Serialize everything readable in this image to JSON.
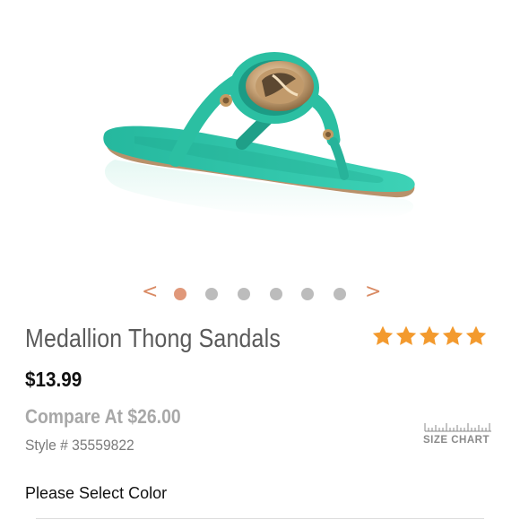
{
  "carousel": {
    "prev_icon": "chevron-left-icon",
    "next_icon": "chevron-right-icon",
    "prev_glyph": "<",
    "next_glyph": ">",
    "dot_count": 6,
    "active_index": 0
  },
  "product": {
    "title": "Medallion Thong Sandals",
    "rating_stars": 5,
    "rating_max": 5,
    "price": "$13.99",
    "compare_price": "Compare At $26.00",
    "style_number": "Style # 35559822",
    "size_chart_label": "SIZE CHART",
    "size_chart_icon": "ruler-icon",
    "select_color_prompt": "Please Select Color"
  },
  "colors": {
    "accent": "#e0987a",
    "star": "#f39a2e",
    "sandal": "#2ec4a7",
    "text_muted": "#a8a8a8"
  }
}
